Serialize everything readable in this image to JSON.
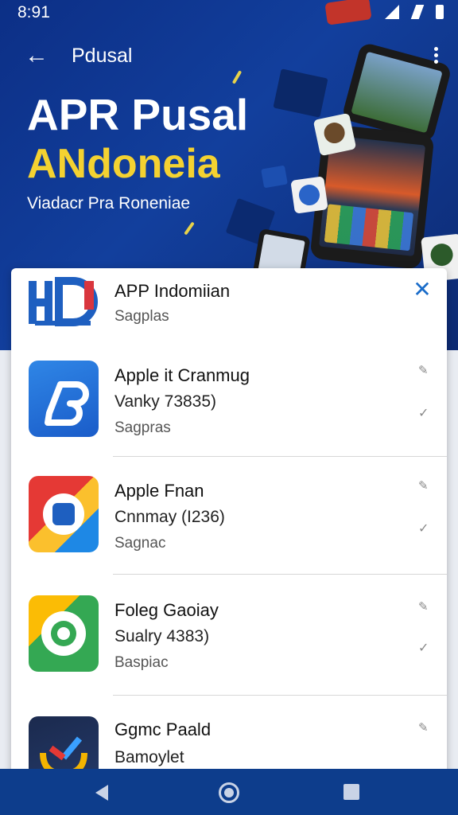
{
  "status_bar": {
    "time": "8:91"
  },
  "app_bar": {
    "title": "Pdusal"
  },
  "hero": {
    "title": "APR Pusal",
    "subtitle": "ANdoneia",
    "tagline": "Viadacr Pra Ronenіae"
  },
  "list": {
    "items": [
      {
        "name": "APP Indomiian",
        "detail": "",
        "meta": "Sagplas"
      },
      {
        "name": "Apple it Cranmug",
        "detail": "Vanky 73835)",
        "meta": "Sagpras"
      },
      {
        "name": "Apple Fnan",
        "detail": "Cnnmay (I236)",
        "meta": "Sagnac"
      },
      {
        "name": "Foleg Gaoiay",
        "detail": "Sualry 4383)",
        "meta": "Baspiac"
      },
      {
        "name": "Ggmc Paald",
        "detail": "Bamoylet",
        "meta": ""
      }
    ]
  },
  "colors": {
    "hero_bg": "#123f9d",
    "accent_yellow": "#f4d231",
    "close_blue": "#1a6cc9",
    "nav_bg": "#0d3d8c"
  },
  "icons": {
    "back": "arrow-left-icon",
    "overflow": "more-vert-icon",
    "close": "close-icon",
    "edit": "pencil-icon",
    "done": "check-icon"
  }
}
